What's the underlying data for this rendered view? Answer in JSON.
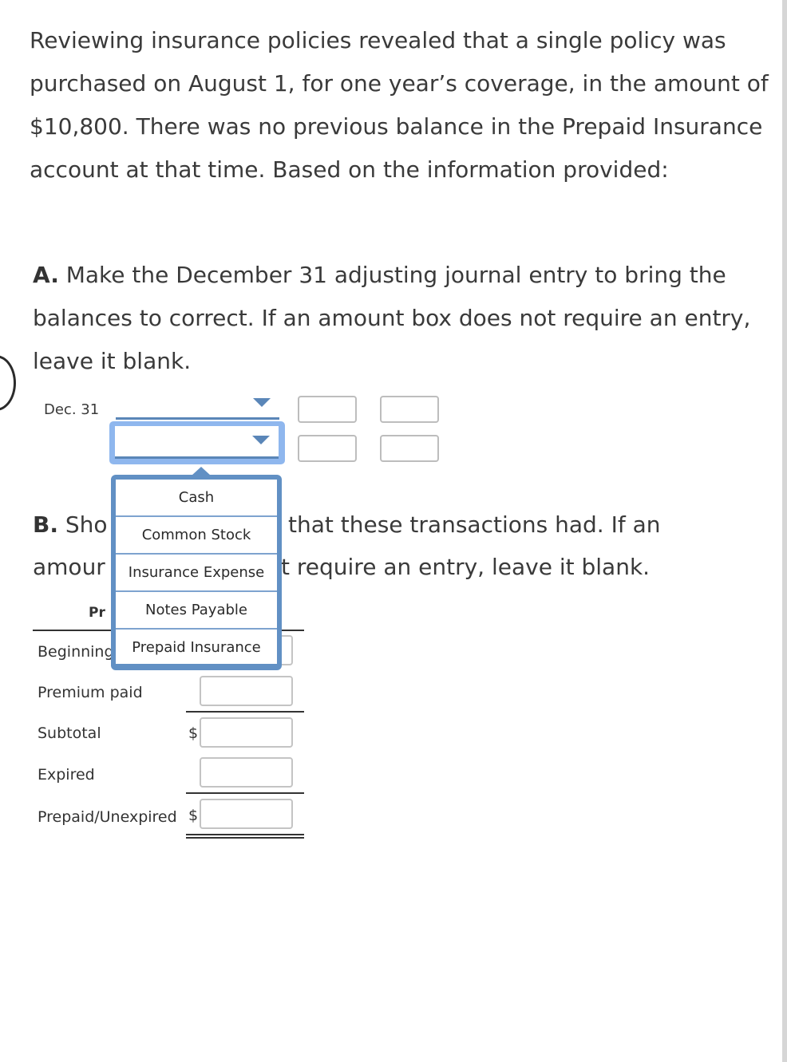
{
  "intro_text": "Reviewing insurance policies revealed that a single policy was purchased on August 1, for one year’s coverage, in the amount of $10,800. There was no previous balance in the Prepaid Insurance account at that time. Based on the information provided:",
  "part_a": {
    "label": "A.",
    "text": " Make the December 31 adjusting journal entry to bring the balances to correct. If an amount box does not require an entry, leave it blank.",
    "journal": {
      "date": "Dec. 31",
      "rows": [
        {
          "account": "",
          "debit": "",
          "credit": ""
        },
        {
          "account": "",
          "debit": "",
          "credit": ""
        }
      ]
    }
  },
  "dropdown": {
    "options": [
      "Cash",
      "Common Stock",
      "Insurance Expense",
      "Notes Payable",
      "Prepaid Insurance"
    ]
  },
  "part_b": {
    "label": "B.",
    "line1_left": " Sho",
    "line1_right": "that these transactions had. If an",
    "line2_left": "amour",
    "line2_right": "t require an entry, leave it blank.",
    "table_header": "Pr",
    "rows": [
      {
        "label": "Beginning",
        "currency": "",
        "value": ""
      },
      {
        "label": "Premium paid",
        "currency": "",
        "value": ""
      },
      {
        "label": "Subtotal",
        "currency": "$",
        "value": ""
      },
      {
        "label": "Expired",
        "currency": "",
        "value": ""
      },
      {
        "label": "Prepaid/Unexpired",
        "currency": "$",
        "value": ""
      }
    ]
  }
}
